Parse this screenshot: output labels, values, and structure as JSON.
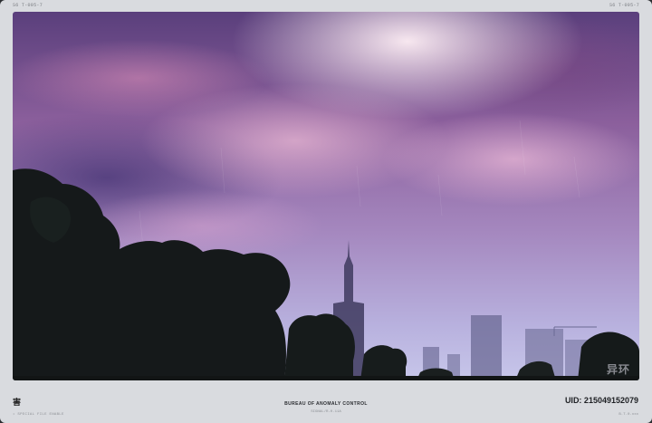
{
  "header": {
    "left_tag": "S6 T-095-7",
    "right_tag": "S6 T-095-7"
  },
  "photo": {
    "description_icon": "landscape-photo",
    "watermark": "异环",
    "sky_colors": {
      "top": "#5a3f7c",
      "mid": "#a588bf",
      "horizon": "#c7c6ea",
      "highlight": "#fff0f5"
    }
  },
  "footer": {
    "left_glyph": "害",
    "left_sub": "• SPECIAL FILE ENABLE",
    "center_title": "BUREAU OF ANOMALY CONTROL",
    "center_sub": "SIGNAL/R-0.11A",
    "uid_label": "UID: 215049152079",
    "right_sub": "B.T.0.xxx"
  }
}
